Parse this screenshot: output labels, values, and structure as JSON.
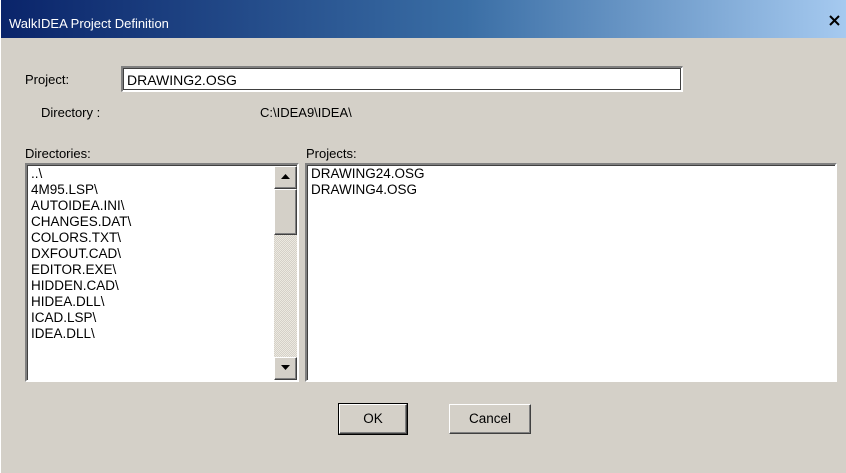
{
  "window": {
    "title": "WalkIDEA Project Definition",
    "close_glyph": "✕"
  },
  "form": {
    "project_label": "Project:",
    "project_value": "DRAWING2.OSG",
    "directory_label": "Directory :",
    "directory_value": "C:\\IDEA9\\IDEA\\",
    "directories_label": "Directories:",
    "projects_label": "Projects:"
  },
  "directories": [
    "..\\",
    "4M95.LSP\\",
    "AUTOIDEA.INI\\",
    "CHANGES.DAT\\",
    "COLORS.TXT\\",
    "DXFOUT.CAD\\",
    "EDITOR.EXE\\",
    "HIDDEN.CAD\\",
    "HIDEA.DLL\\",
    "ICAD.LSP\\",
    "IDEA.DLL\\"
  ],
  "projects": [
    "DRAWING24.OSG",
    "DRAWING4.OSG"
  ],
  "buttons": {
    "ok": "OK",
    "cancel": "Cancel"
  },
  "icons": {
    "close": "close-icon",
    "scroll_up": "arrow-up-icon",
    "scroll_down": "arrow-down-icon"
  }
}
